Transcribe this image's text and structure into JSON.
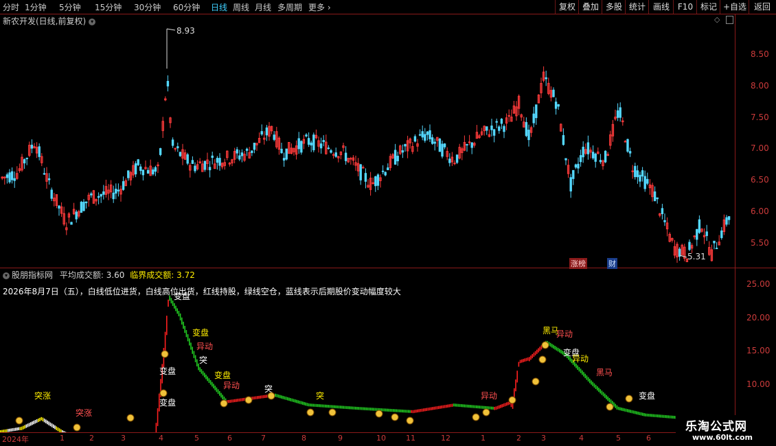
{
  "toolbar": {
    "periods": [
      "分时",
      "1分钟",
      "5分钟",
      "15分钟",
      "30分钟",
      "60分钟",
      "日线",
      "周线",
      "月线",
      "多周期",
      "更多"
    ],
    "active_period": "日线",
    "more_arrow": "›",
    "right_buttons": [
      "复权",
      "叠加",
      "多股",
      "统计",
      "画线",
      "F10",
      "标记",
      "+自选",
      "返回"
    ]
  },
  "main_chart": {
    "title": "新农开发(日线,前复权)",
    "high_label": "8.93",
    "low_label": "5.31",
    "price_axis": [
      "8.50",
      "8.00",
      "7.50",
      "7.00",
      "6.50",
      "6.00",
      "5.50"
    ],
    "tags": [
      "涨榜",
      "财"
    ],
    "icon_diamond": "◇",
    "colors": {
      "up": "#ff3b3b",
      "down": "#54d8ff",
      "frame": "#8b1a1a"
    }
  },
  "indicator": {
    "title": "股朋指标网",
    "avg_label": "平均成交额:",
    "avg_value": "3.60",
    "crit_label": "临界成交额:",
    "crit_value": "3.72",
    "note": "2026年8月7日（五），白线低位进货，白线高位出货，红线持股，绿线空仓，蓝线表示后期股价变动幅度较大",
    "axis": [
      "25.00",
      "20.00",
      "15.00",
      "10.00"
    ],
    "annotations": [
      "变盘",
      "变盘",
      "异动",
      "突",
      "变盘",
      "异动",
      "变盘",
      "异动",
      "黑马",
      "变盘",
      "黑马",
      "异动",
      "变盘",
      "突涨",
      "突涨",
      "突",
      "突",
      "异动",
      "变盘"
    ],
    "colors": {
      "red": "#ff2020",
      "green": "#22cc22",
      "white": "#ffffff",
      "yellow": "#ffee00"
    }
  },
  "date_axis": [
    "2024年",
    "1",
    "2",
    "3",
    "4",
    "5",
    "6",
    "7",
    "8",
    "9",
    "10",
    "11",
    "12",
    "1",
    "2",
    "3",
    "4",
    "5",
    "6"
  ],
  "watermark": {
    "title": "乐淘公式网",
    "url": "www.60lt.com"
  }
}
